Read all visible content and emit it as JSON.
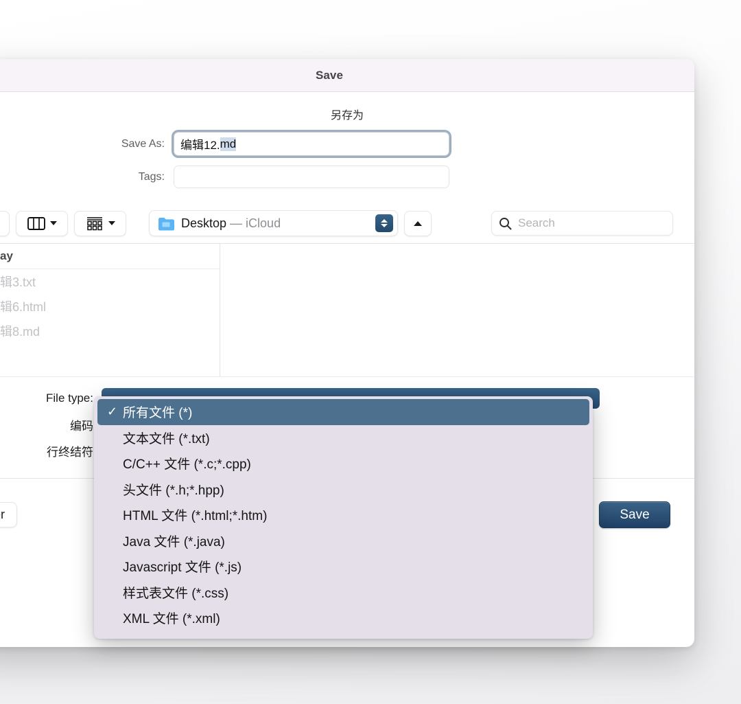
{
  "window": {
    "title": "Save",
    "subtitle": "另存为"
  },
  "form": {
    "save_as_label": "Save As:",
    "save_as_value_plain": "编辑12.",
    "save_as_value_selected": "md",
    "tags_label": "Tags:",
    "tags_value": ""
  },
  "toolbar": {
    "view_icon": "column-view-icon",
    "view_chevron_icon": "chevron-down-icon",
    "group_icon": "group-items-icon",
    "group_chevron_icon": "chevron-down-icon",
    "path_folder_icon": "folder-icon",
    "path_name": "Desktop",
    "path_location": " — iCloud",
    "stepper_icon": "up-down-stepper-icon",
    "up_icon": "chevron-up-icon",
    "search_icon": "search-icon",
    "search_placeholder": "Search"
  },
  "browser": {
    "group_header": "ay",
    "files": [
      "辑3.txt",
      "辑6.html",
      "辑8.md"
    ]
  },
  "options": {
    "file_type_label": "File type:",
    "encoding_label": "编码",
    "line_ending_label": "行终结符"
  },
  "filetype_menu": {
    "selected_index": 0,
    "check_glyph": "✓",
    "items": [
      "所有文件 (*)",
      "文本文件 (*.txt)",
      "C/C++ 文件 (*.c;*.cpp)",
      "头文件 (*.h;*.hpp)",
      "HTML 文件 (*.html;*.htm)",
      "Java 文件 (*.java)",
      "Javascript 文件 (*.js)",
      "样式表文件 (*.css)",
      "XML 文件 (*.xml)"
    ]
  },
  "footer": {
    "new_folder_label": "Folder",
    "save_label": "Save"
  },
  "colors": {
    "accent_save": "#23496c",
    "menu_highlight": "#4c708d",
    "menu_background": "#e5dfe9",
    "titlebar": "#f7f3f8",
    "selection": "#cfdceb"
  }
}
